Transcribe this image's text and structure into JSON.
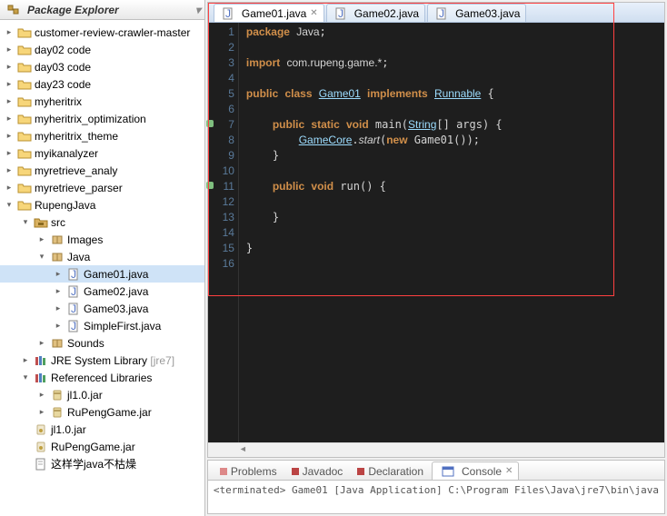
{
  "explorer": {
    "title": "Package Explorer",
    "tree": [
      {
        "d": 0,
        "exp": "closed",
        "icon": "proj",
        "label": "customer-review-crawler-master"
      },
      {
        "d": 0,
        "exp": "closed",
        "icon": "proj",
        "label": "day02 code"
      },
      {
        "d": 0,
        "exp": "closed",
        "icon": "proj",
        "label": "day03 code"
      },
      {
        "d": 0,
        "exp": "closed",
        "icon": "proj",
        "label": "day23 code"
      },
      {
        "d": 0,
        "exp": "closed",
        "icon": "proj",
        "label": "myheritrix"
      },
      {
        "d": 0,
        "exp": "closed",
        "icon": "proj",
        "label": "myheritrix_optimization"
      },
      {
        "d": 0,
        "exp": "closed",
        "icon": "proj",
        "label": "myheritrix_theme"
      },
      {
        "d": 0,
        "exp": "closed",
        "icon": "proj",
        "label": "myikanalyzer"
      },
      {
        "d": 0,
        "exp": "closed",
        "icon": "proj",
        "label": "myretrieve_analy"
      },
      {
        "d": 0,
        "exp": "closed",
        "icon": "proj",
        "label": "myretrieve_parser"
      },
      {
        "d": 0,
        "exp": "open",
        "icon": "proj",
        "label": "RupengJava"
      },
      {
        "d": 1,
        "exp": "open",
        "icon": "srcfolder",
        "label": "src"
      },
      {
        "d": 2,
        "exp": "closed",
        "icon": "pkg",
        "label": "Images"
      },
      {
        "d": 2,
        "exp": "open",
        "icon": "pkg",
        "label": "Java"
      },
      {
        "d": 3,
        "exp": "closed",
        "icon": "jfile",
        "label": "Game01.java",
        "selected": true
      },
      {
        "d": 3,
        "exp": "closed",
        "icon": "jfile",
        "label": "Game02.java"
      },
      {
        "d": 3,
        "exp": "closed",
        "icon": "jfile",
        "label": "Game03.java"
      },
      {
        "d": 3,
        "exp": "closed",
        "icon": "jfile",
        "label": "SimpleFirst.java"
      },
      {
        "d": 2,
        "exp": "closed",
        "icon": "pkg",
        "label": "Sounds"
      },
      {
        "d": 1,
        "exp": "closed",
        "icon": "lib",
        "label": "JRE System Library",
        "deco": " [jre7]"
      },
      {
        "d": 1,
        "exp": "open",
        "icon": "lib",
        "label": "Referenced Libraries"
      },
      {
        "d": 2,
        "exp": "closed",
        "icon": "jar",
        "label": "jl1.0.jar"
      },
      {
        "d": 2,
        "exp": "closed",
        "icon": "jar",
        "label": "RuPengGame.jar"
      },
      {
        "d": 1,
        "exp": "none",
        "icon": "jarfile",
        "label": "jl1.0.jar"
      },
      {
        "d": 1,
        "exp": "none",
        "icon": "jarfile",
        "label": "RuPengGame.jar"
      },
      {
        "d": 1,
        "exp": "none",
        "icon": "txt",
        "label": "这样学java不枯燥"
      }
    ]
  },
  "editor": {
    "tabs": [
      {
        "label": "Game01.java",
        "active": true,
        "close": true
      },
      {
        "label": "Game02.java",
        "active": false,
        "close": false
      },
      {
        "label": "Game03.java",
        "active": false,
        "close": false
      }
    ],
    "code": {
      "package_kw": "package",
      "package_name": "Java",
      "import_kw": "import",
      "import_path": "com.rupeng.game.*",
      "public_kw": "public",
      "class_kw": "class",
      "class_name": "Game01",
      "implements_kw": "implements",
      "iface": "Runnable",
      "static_kw": "static",
      "void_kw": "void",
      "main": "main",
      "string": "String",
      "args": "args",
      "gamecore": "GameCore",
      "start": "start",
      "new_kw": "new",
      "game01ctor": "Game01",
      "run": "run"
    },
    "lines": 16
  },
  "bottom": {
    "tabs": [
      {
        "label": "Problems",
        "color": "#d88"
      },
      {
        "label": "Javadoc",
        "color": "#b44"
      },
      {
        "label": "Declaration",
        "color": "#b44"
      },
      {
        "label": "Console",
        "active": true
      }
    ],
    "console_text": "<terminated> Game01 [Java Application] C:\\Program Files\\Java\\jre7\\bin\\java"
  }
}
